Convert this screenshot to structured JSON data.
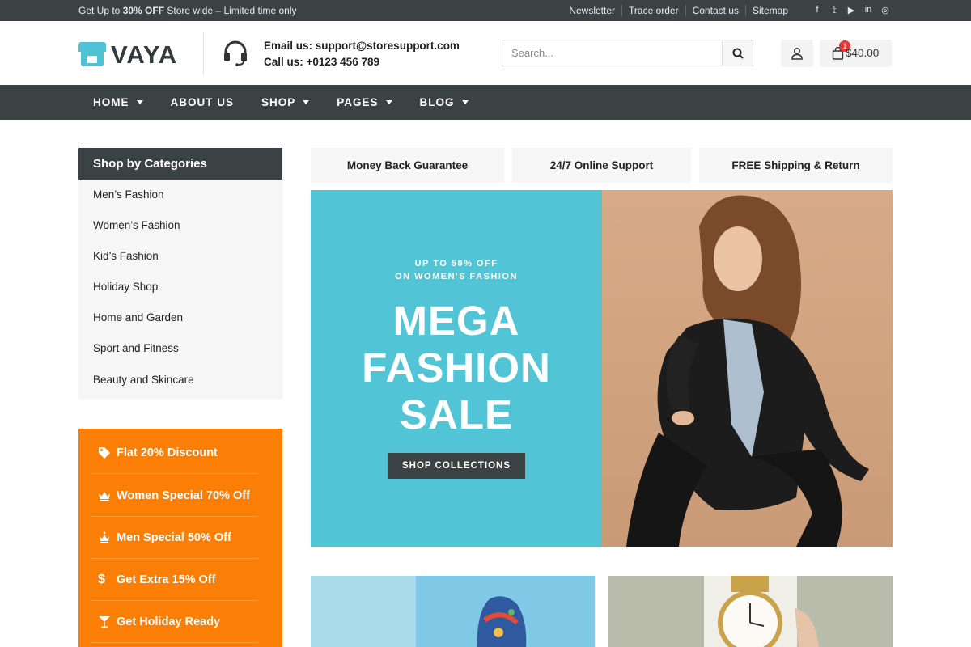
{
  "topbar": {
    "promo_prefix": "Get Up to",
    "promo_bold": "30% OFF",
    "promo_suffix": "Store wide – Limited time only",
    "links": [
      "Newsletter",
      "Trace order",
      "Contact us",
      "Sitemap"
    ],
    "social_icons": [
      "facebook-icon",
      "twitter-icon",
      "youtube-icon",
      "linkedin-icon",
      "instagram-icon"
    ],
    "social_glyphs": [
      "f",
      "𝕥",
      "▶",
      "in",
      "◎"
    ]
  },
  "header": {
    "logo_text": "VAYA",
    "email_line": "Email us: support@storesupport.com",
    "call_line": "Call us: +0123 456 789",
    "search_placeholder": "Search...",
    "cart_count": "1",
    "cart_total": "$40.00"
  },
  "nav": {
    "items": [
      "HOME",
      "ABOUT US",
      "SHOP",
      "PAGES",
      "BLOG"
    ]
  },
  "categories": {
    "title": "Shop by Categories",
    "items": [
      "Men’s Fashion",
      "Women’s Fashion",
      "Kid’s Fashion",
      "Holiday Shop",
      "Home and Garden",
      "Sport and Fitness",
      "Beauty and Skincare"
    ]
  },
  "promos": {
    "items": [
      {
        "label": "Flat 20% Discount",
        "icon": "tag-icon"
      },
      {
        "label": "Women Special 70% Off",
        "icon": "crown-icon"
      },
      {
        "label": "Men Special 50% Off",
        "icon": "crown-icon"
      },
      {
        "label": "Get Extra 15% Off",
        "icon": "dollar-icon"
      },
      {
        "label": "Get Holiday Ready",
        "icon": "cocktail-icon"
      }
    ]
  },
  "features": [
    "Money Back Guarantee",
    "24/7 Online Support",
    "FREE Shipping & Return"
  ],
  "hero": {
    "kicker_line1": "UP TO 50% OFF",
    "kicker_line2": "ON WOMEN'S FASHION",
    "title_lines": [
      "MEGA",
      "FASHION",
      "SALE"
    ],
    "cta": "SHOP COLLECTIONS"
  },
  "colors": {
    "dark": "#3b4244",
    "accent_teal": "#51c5d5",
    "accent_orange": "#fb7f06",
    "cart_badge": "#e53935"
  }
}
